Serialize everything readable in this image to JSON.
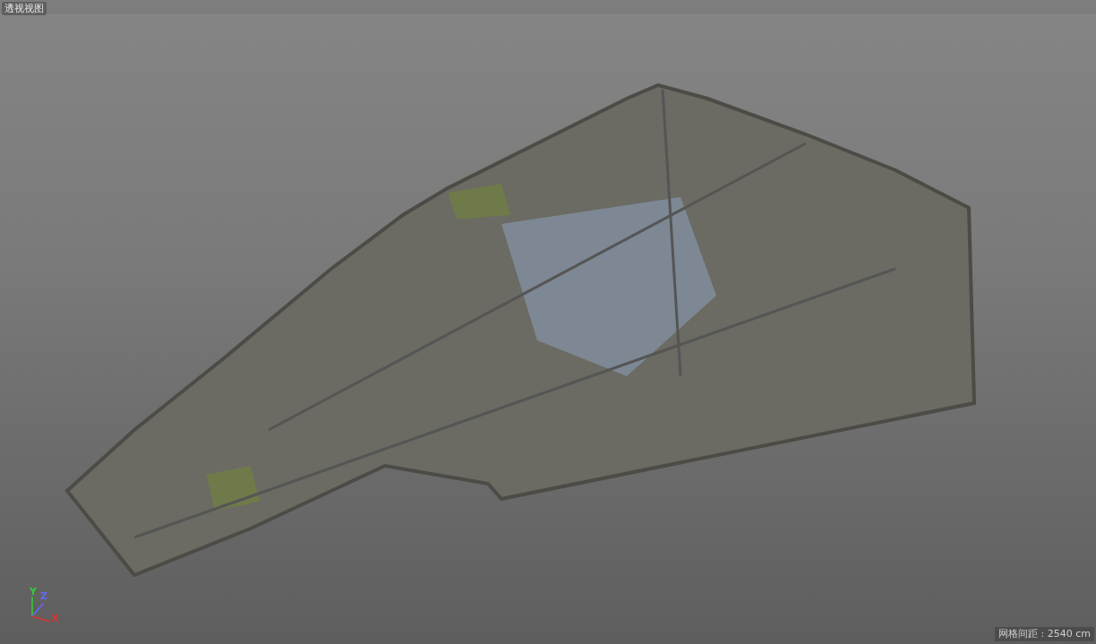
{
  "viewport": {
    "title": "透视视图",
    "grid_spacing": "网格间距 : 2540 cm"
  },
  "axes": [
    {
      "label": "Y",
      "color": "#33cc33"
    },
    {
      "label": "Z",
      "color": "#6666ff"
    },
    {
      "label": "X",
      "color": "#dd3333"
    }
  ]
}
